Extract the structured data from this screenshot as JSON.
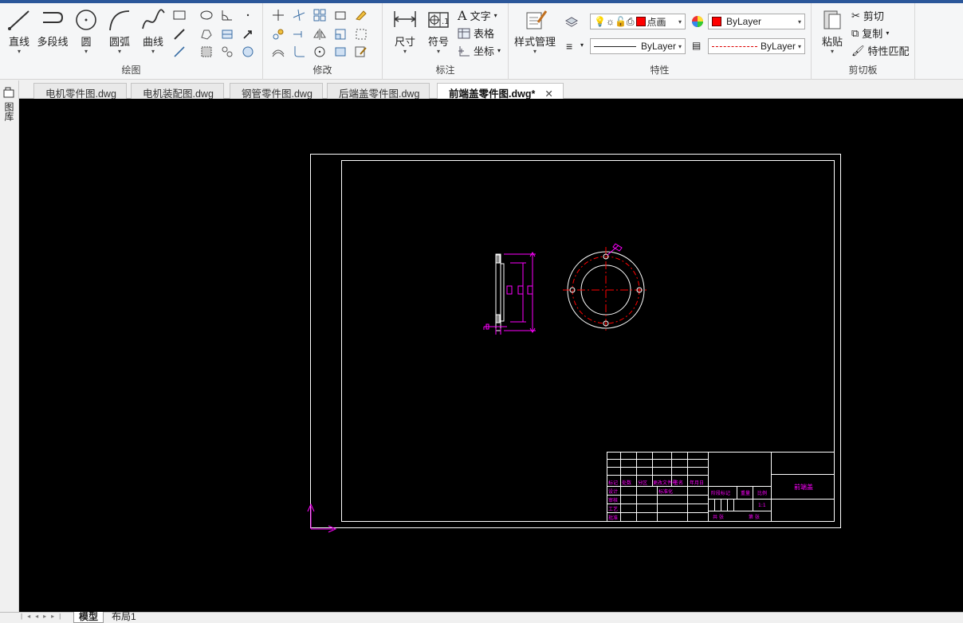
{
  "ribbon": {
    "draw": {
      "label": "绘图",
      "line": "直线",
      "polyline": "多段线",
      "circle": "圆",
      "arc": "圆弧",
      "curve": "曲线"
    },
    "modify": {
      "label": "修改"
    },
    "annotate": {
      "label": "标注",
      "dimension": "尺寸",
      "symbol": "符号",
      "text": "文字",
      "table": "表格",
      "coordinate": "坐标"
    },
    "style": {
      "manager": "样式管理"
    },
    "properties": {
      "label": "特性",
      "layer_value": "点画",
      "color_value": "ByLayer",
      "linetype_value": "ByLayer",
      "lineweight_value": "ByLayer",
      "color_swatch": "#ff0000"
    },
    "clipboard": {
      "label": "剪切板",
      "paste": "粘贴",
      "cut": "剪切",
      "copy": "复制",
      "match": "特性匹配"
    }
  },
  "tabs": [
    {
      "label": "电机零件图.dwg"
    },
    {
      "label": "电机装配图.dwg"
    },
    {
      "label": "钢管零件图.dwg"
    },
    {
      "label": "后端盖零件图.dwg"
    },
    {
      "label": "前端盖零件图.dwg*",
      "active": true
    }
  ],
  "sidebar": {
    "label": "图库"
  },
  "drawing": {
    "titleblock_name": "前端盖",
    "titleblock_labels": {
      "mark": "标记",
      "count": "处数",
      "zone": "分区",
      "change_doc": "更改文件号",
      "signature": "签名",
      "date": "年月日",
      "designer": "设计",
      "standardize": "标准化",
      "review": "审核",
      "process": "工艺",
      "approve": "批准",
      "stage_mark": "阶段标记",
      "weight": "重量",
      "scale": "比例",
      "total": "共 张",
      "sheet": "第 张"
    }
  },
  "bottom": {
    "tabs": [
      {
        "label": "模型",
        "active": true
      },
      {
        "label": "布局1"
      }
    ]
  },
  "colors": {
    "accent": "#2b579a",
    "magenta": "#ff00ff",
    "red_center": "#ff0000",
    "canvas": "#000000"
  }
}
